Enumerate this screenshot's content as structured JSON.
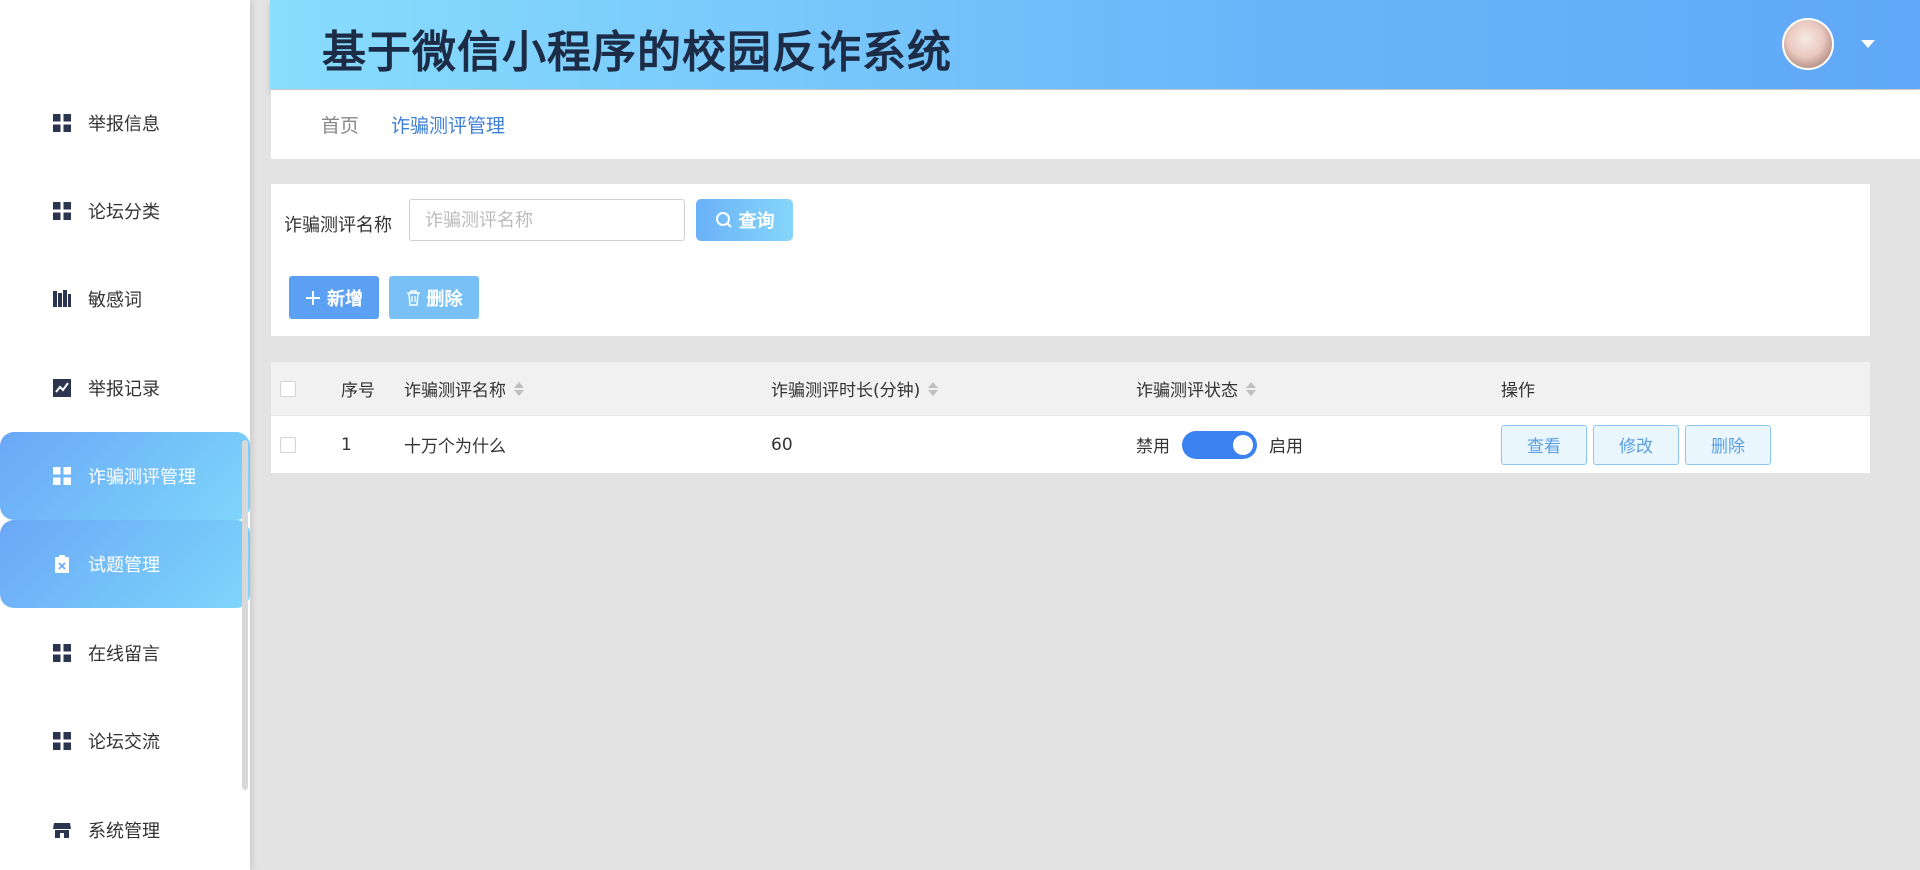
{
  "app": {
    "title": "基于微信小程序的校园反诈系统"
  },
  "sidebar": {
    "items": [
      {
        "label": "举报信息",
        "icon": "grid-icon",
        "active": false
      },
      {
        "label": "论坛分类",
        "icon": "grid-icon",
        "active": false
      },
      {
        "label": "敏感词",
        "icon": "books-icon",
        "active": false
      },
      {
        "label": "举报记录",
        "icon": "trend-chart-icon",
        "active": false
      },
      {
        "label": "诈骗测评管理",
        "icon": "grid-icon",
        "active": true
      },
      {
        "label": "试题管理",
        "icon": "clipboard-x-icon",
        "active": true
      },
      {
        "label": "在线留言",
        "icon": "grid-icon",
        "active": false
      },
      {
        "label": "论坛交流",
        "icon": "grid-icon",
        "active": false
      },
      {
        "label": "系统管理",
        "icon": "store-icon",
        "active": false
      }
    ]
  },
  "breadcrumb": {
    "home": "首页",
    "current": "诈骗测评管理"
  },
  "search": {
    "label": "诈骗测评名称",
    "placeholder": "诈骗测评名称",
    "value": "",
    "button_label": "查询"
  },
  "toolbar": {
    "add_label": "新增",
    "delete_label": "删除"
  },
  "table": {
    "columns": {
      "index": "序号",
      "name": "诈骗测评名称",
      "duration": "诈骗测评时长(分钟)",
      "status": "诈骗测评状态",
      "actions": "操作"
    },
    "rows": [
      {
        "index": "1",
        "name": "十万个为什么",
        "duration": "60",
        "status_off_label": "禁用",
        "status_on_label": "启用",
        "status_enabled": true,
        "view_label": "查看",
        "edit_label": "修改",
        "delete_label": "删除"
      }
    ]
  },
  "colors": {
    "accent": "#5ca0f3",
    "switch_on": "#3b82f0",
    "header_start": "#88ddfc",
    "header_end": "#60a8f7"
  }
}
